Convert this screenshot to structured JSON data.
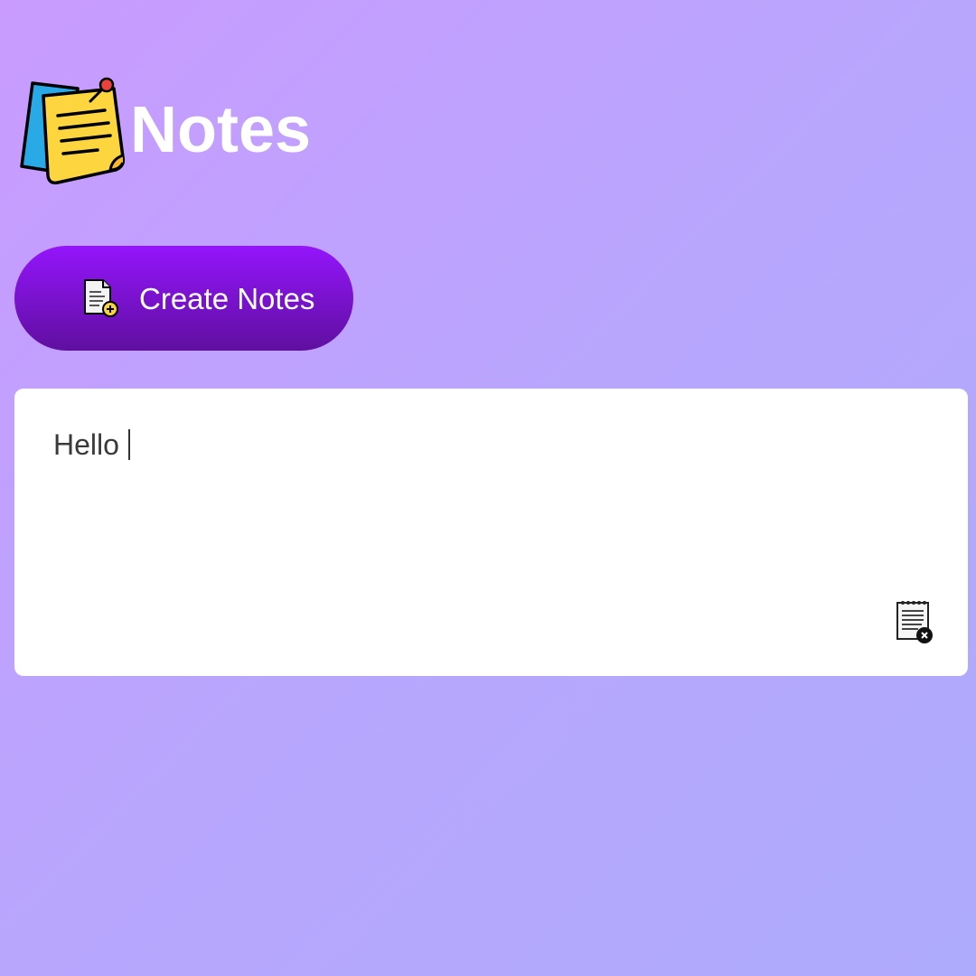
{
  "header": {
    "logo_icon": "sticky-notes-icon",
    "title": "Notes"
  },
  "toolbar": {
    "create_icon": "add-note-icon",
    "create_label": "Create Notes"
  },
  "notes": [
    {
      "text": "Hello",
      "delete_icon": "delete-note-icon"
    }
  ],
  "colors": {
    "background_start": "#c99bff",
    "background_end": "#aeabfc",
    "button_top": "#9415fb",
    "button_bottom": "#5f0fa0",
    "card": "#ffffff"
  }
}
